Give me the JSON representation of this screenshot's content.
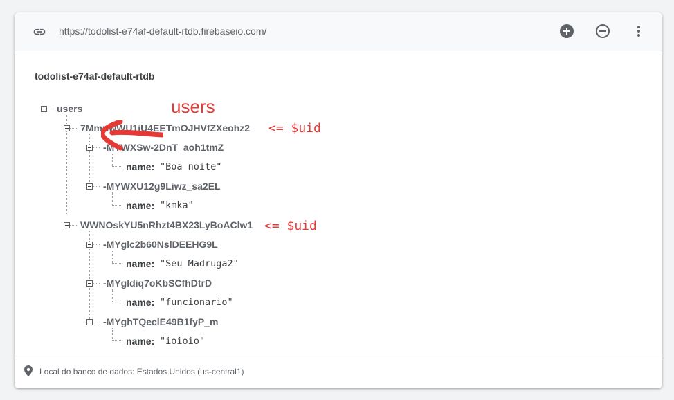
{
  "url": "https://todolist-e74af-default-rtdb.firebaseio.com/",
  "toolbar": {
    "add": "plus-circle-icon",
    "remove": "minus-circle-icon",
    "menu": "more-vert-icon"
  },
  "tree": {
    "root": "todolist-e74af-default-rtdb",
    "users": "users",
    "uid1": {
      "key": "7MmriwWU1jU4EETmOJHVfZXeohz2",
      "tasks": [
        {
          "key": "-MYWXSw-2DnT_aoh1tmZ",
          "field": "name:",
          "value": "\"Boa noite\""
        },
        {
          "key": "-MYWXU12g9Liwz_sa2EL",
          "field": "name:",
          "value": "\"kmka\""
        }
      ]
    },
    "uid2": {
      "key": "WWNOskYU5nRhzt4BX23LyBoAClw1",
      "tasks": [
        {
          "key": "-MYglc2b60NslDEEHG9L",
          "field": "name:",
          "value": "\"Seu Madruga2\""
        },
        {
          "key": "-MYgldiq7oKbSCfhDtrD",
          "field": "name:",
          "value": "\"funcionario\""
        },
        {
          "key": "-MYghTQeclE49B1fyP_m",
          "field": "name:",
          "value": "\"ioioio\""
        }
      ]
    }
  },
  "annotations": {
    "users": "users",
    "uid1": "<= $uid",
    "uid2": "<= $uid"
  },
  "colors": {
    "annotation": "#e53935",
    "text": "#3c4043",
    "muted": "#5f6368"
  },
  "footer": {
    "location": "Local do banco de dados: Estados Unidos (us-central1)"
  }
}
